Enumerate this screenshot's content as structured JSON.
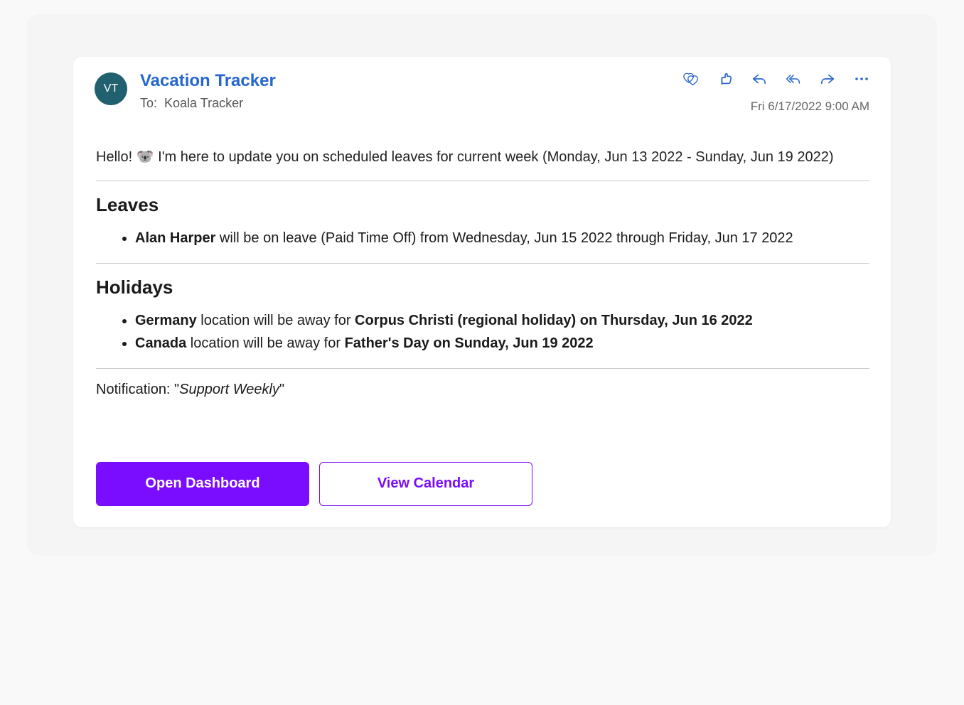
{
  "header": {
    "avatar_initials": "VT",
    "sender": "Vacation Tracker",
    "to_label": "To:",
    "recipient": "Koala Tracker",
    "timestamp": "Fri 6/17/2022 9:00 AM"
  },
  "intro": "Hello! 🐨 I'm here to update you on scheduled leaves for current week (Monday, Jun 13 2022 - Sunday, Jun 19 2022)",
  "leaves": {
    "heading": "Leaves",
    "items": [
      {
        "name": "Alan Harper",
        "rest": " will be on leave (Paid Time Off) from Wednesday, Jun 15 2022 through Friday, Jun 17 2022"
      }
    ]
  },
  "holidays": {
    "heading": "Holidays",
    "items": [
      {
        "loc": "Germany",
        "mid": " location will be away for ",
        "occ": "Corpus Christi (regional holiday) on Thursday, Jun 16 2022"
      },
      {
        "loc": "Canada",
        "mid": " location will be away for ",
        "occ": "Father's Day on Sunday, Jun 19 2022"
      }
    ]
  },
  "notification": {
    "label": "Notification: \"",
    "name": "Support Weekly",
    "close": "\""
  },
  "buttons": {
    "primary": "Open Dashboard",
    "secondary": "View Calendar"
  }
}
